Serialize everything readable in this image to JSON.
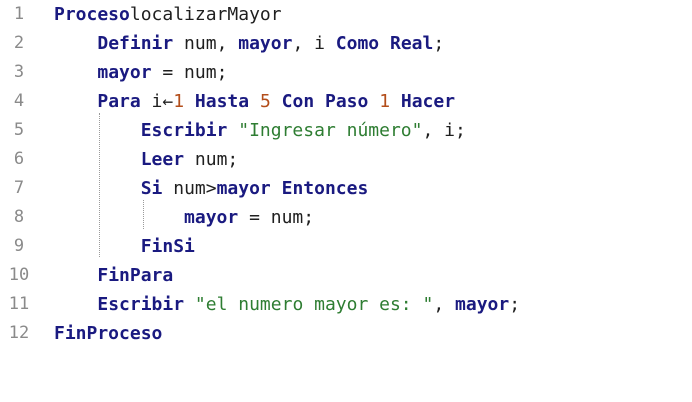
{
  "editor": {
    "lines": [
      {
        "n": "1",
        "tokens": [
          [
            "kw",
            "Proceso"
          ],
          [
            "",
            "localizarMayor"
          ]
        ]
      },
      {
        "n": "2",
        "tokens": [
          [
            "",
            "    "
          ],
          [
            "kw",
            "Definir"
          ],
          [
            "",
            " num, "
          ],
          [
            "kw",
            "mayor"
          ],
          [
            "",
            ", i "
          ],
          [
            "kw",
            "Como Real"
          ],
          [
            "",
            ";"
          ]
        ]
      },
      {
        "n": "3",
        "tokens": [
          [
            "",
            "    "
          ],
          [
            "kw",
            "mayor"
          ],
          [
            "",
            " = num;"
          ]
        ]
      },
      {
        "n": "4",
        "tokens": [
          [
            "",
            "    "
          ],
          [
            "kw",
            "Para"
          ],
          [
            "",
            " i←"
          ],
          [
            "num",
            "1"
          ],
          [
            "",
            " "
          ],
          [
            "kw",
            "Hasta"
          ],
          [
            "",
            " "
          ],
          [
            "num",
            "5"
          ],
          [
            "",
            " "
          ],
          [
            "kw",
            "Con Paso"
          ],
          [
            "",
            " "
          ],
          [
            "num",
            "1"
          ],
          [
            "",
            " "
          ],
          [
            "kw",
            "Hacer"
          ]
        ]
      },
      {
        "n": "5",
        "tokens": [
          [
            "",
            "        "
          ],
          [
            "kw",
            "Escribir"
          ],
          [
            "",
            " "
          ],
          [
            "str",
            "\"Ingresar número\""
          ],
          [
            "",
            ", i;"
          ]
        ]
      },
      {
        "n": "6",
        "tokens": [
          [
            "",
            "        "
          ],
          [
            "kw",
            "Leer"
          ],
          [
            "",
            " num;"
          ]
        ]
      },
      {
        "n": "7",
        "tokens": [
          [
            "",
            "        "
          ],
          [
            "kw",
            "Si"
          ],
          [
            "",
            " num>"
          ],
          [
            "kw",
            "mayor"
          ],
          [
            "",
            " "
          ],
          [
            "kw",
            "Entonces"
          ]
        ]
      },
      {
        "n": "8",
        "tokens": [
          [
            "",
            "            "
          ],
          [
            "kw",
            "mayor"
          ],
          [
            "",
            " = num;"
          ]
        ]
      },
      {
        "n": "9",
        "tokens": [
          [
            "",
            "        "
          ],
          [
            "kw",
            "FinSi"
          ]
        ]
      },
      {
        "n": "10",
        "tokens": [
          [
            "",
            "    "
          ],
          [
            "kw",
            "FinPara"
          ]
        ]
      },
      {
        "n": "11",
        "tokens": [
          [
            "",
            "    "
          ],
          [
            "kw",
            "Escribir"
          ],
          [
            "",
            " "
          ],
          [
            "str",
            "\"el numero mayor es: \""
          ],
          [
            "",
            ", "
          ],
          [
            "kw",
            "mayor"
          ],
          [
            "",
            ";"
          ]
        ]
      },
      {
        "n": "12",
        "tokens": [
          [
            "kw",
            "FinProceso"
          ]
        ]
      }
    ]
  },
  "colors": {
    "keyword": "#1a1a80",
    "string": "#2e7d32",
    "number": "#b34d1a",
    "line_number": "#8a8a8a",
    "text": "#1f1f1f"
  }
}
